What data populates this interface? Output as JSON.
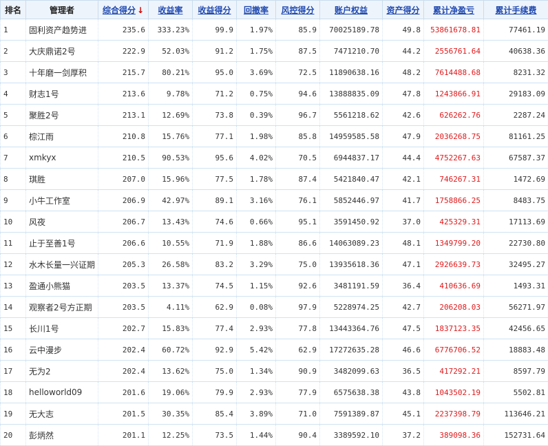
{
  "colors": {
    "header_bg": "#eef4fb",
    "link": "#1f49b0",
    "sort_arrow": "#d40000",
    "profit": "#e0191b"
  },
  "headers": {
    "rank": "排名",
    "manager": "管理者",
    "total_score": "综合得分",
    "sort_indicator": "↓",
    "return_rate": "收益率",
    "return_score": "收益得分",
    "drawdown": "回撤率",
    "risk_score": "风控得分",
    "equity": "账户权益",
    "asset_score": "资产得分",
    "net_profit": "累计净盈亏",
    "fees": "累计手续费"
  },
  "rows": [
    {
      "rank": "1",
      "name": "固利资产趋势进",
      "total": "235.6",
      "ret": "333.23%",
      "ret_score": "99.9",
      "dd": "1.97%",
      "risk": "85.9",
      "equity": "70025189.78",
      "asset": "49.8",
      "profit": "53861678.81",
      "fees": "77461.19"
    },
    {
      "rank": "2",
      "name": "大庆鼎诺2号",
      "total": "222.9",
      "ret": "52.03%",
      "ret_score": "91.2",
      "dd": "1.75%",
      "risk": "87.5",
      "equity": "7471210.70",
      "asset": "44.2",
      "profit": "2556761.64",
      "fees": "40638.36"
    },
    {
      "rank": "3",
      "name": "十年磨一剑厚积",
      "total": "215.7",
      "ret": "80.21%",
      "ret_score": "95.0",
      "dd": "3.69%",
      "risk": "72.5",
      "equity": "11890638.16",
      "asset": "48.2",
      "profit": "7614488.68",
      "fees": "8231.32"
    },
    {
      "rank": "4",
      "name": "财志1号",
      "total": "213.6",
      "ret": "9.78%",
      "ret_score": "71.2",
      "dd": "0.75%",
      "risk": "94.6",
      "equity": "13888835.09",
      "asset": "47.8",
      "profit": "1243866.91",
      "fees": "29183.09"
    },
    {
      "rank": "5",
      "name": "聚胜2号",
      "total": "213.1",
      "ret": "12.69%",
      "ret_score": "73.8",
      "dd": "0.39%",
      "risk": "96.7",
      "equity": "5561218.62",
      "asset": "42.6",
      "profit": "626262.76",
      "fees": "2287.24"
    },
    {
      "rank": "6",
      "name": "棕江雨",
      "total": "210.8",
      "ret": "15.76%",
      "ret_score": "77.1",
      "dd": "1.98%",
      "risk": "85.8",
      "equity": "14959585.58",
      "asset": "47.9",
      "profit": "2036268.75",
      "fees": "81161.25"
    },
    {
      "rank": "7",
      "name": "xmkyx",
      "total": "210.5",
      "ret": "90.53%",
      "ret_score": "95.6",
      "dd": "4.02%",
      "risk": "70.5",
      "equity": "6944837.17",
      "asset": "44.4",
      "profit": "4752267.63",
      "fees": "67587.37"
    },
    {
      "rank": "8",
      "name": "琪胜",
      "total": "207.0",
      "ret": "15.96%",
      "ret_score": "77.5",
      "dd": "1.78%",
      "risk": "87.4",
      "equity": "5421840.47",
      "asset": "42.1",
      "profit": "746267.31",
      "fees": "1472.69"
    },
    {
      "rank": "9",
      "name": "小牛工作室",
      "total": "206.9",
      "ret": "42.97%",
      "ret_score": "89.1",
      "dd": "3.16%",
      "risk": "76.1",
      "equity": "5852446.97",
      "asset": "41.7",
      "profit": "1758866.25",
      "fees": "8483.75"
    },
    {
      "rank": "10",
      "name": "风夜",
      "total": "206.7",
      "ret": "13.43%",
      "ret_score": "74.6",
      "dd": "0.66%",
      "risk": "95.1",
      "equity": "3591450.92",
      "asset": "37.0",
      "profit": "425329.31",
      "fees": "17113.69"
    },
    {
      "rank": "11",
      "name": "止于至善1号",
      "total": "206.6",
      "ret": "10.55%",
      "ret_score": "71.9",
      "dd": "1.88%",
      "risk": "86.6",
      "equity": "14063089.23",
      "asset": "48.1",
      "profit": "1349799.20",
      "fees": "22730.80"
    },
    {
      "rank": "12",
      "name": "水木长量一兴证期",
      "total": "205.3",
      "ret": "26.58%",
      "ret_score": "83.2",
      "dd": "3.29%",
      "risk": "75.0",
      "equity": "13935618.36",
      "asset": "47.1",
      "profit": "2926639.73",
      "fees": "32495.27"
    },
    {
      "rank": "13",
      "name": "盈通小熊猫",
      "total": "203.5",
      "ret": "13.37%",
      "ret_score": "74.5",
      "dd": "1.15%",
      "risk": "92.6",
      "equity": "3481191.59",
      "asset": "36.4",
      "profit": "410636.69",
      "fees": "1493.31"
    },
    {
      "rank": "14",
      "name": "观察者2号方正期",
      "total": "203.5",
      "ret": "4.11%",
      "ret_score": "62.9",
      "dd": "0.08%",
      "risk": "97.9",
      "equity": "5228974.25",
      "asset": "42.7",
      "profit": "206208.03",
      "fees": "56271.97"
    },
    {
      "rank": "15",
      "name": "长川1号",
      "total": "202.7",
      "ret": "15.83%",
      "ret_score": "77.4",
      "dd": "2.93%",
      "risk": "77.8",
      "equity": "13443364.76",
      "asset": "47.5",
      "profit": "1837123.35",
      "fees": "42456.65"
    },
    {
      "rank": "16",
      "name": "云中漫步",
      "total": "202.4",
      "ret": "60.72%",
      "ret_score": "92.9",
      "dd": "5.42%",
      "risk": "62.9",
      "equity": "17272635.28",
      "asset": "46.6",
      "profit": "6776706.52",
      "fees": "18883.48"
    },
    {
      "rank": "17",
      "name": "无为2",
      "total": "202.4",
      "ret": "13.62%",
      "ret_score": "75.0",
      "dd": "1.34%",
      "risk": "90.9",
      "equity": "3482099.63",
      "asset": "36.5",
      "profit": "417292.21",
      "fees": "8597.79"
    },
    {
      "rank": "18",
      "name": "helloworld09",
      "total": "201.6",
      "ret": "19.06%",
      "ret_score": "79.9",
      "dd": "2.93%",
      "risk": "77.9",
      "equity": "6575638.38",
      "asset": "43.8",
      "profit": "1043502.19",
      "fees": "5502.81"
    },
    {
      "rank": "19",
      "name": "无大志",
      "total": "201.5",
      "ret": "30.35%",
      "ret_score": "85.4",
      "dd": "3.89%",
      "risk": "71.0",
      "equity": "7591389.87",
      "asset": "45.1",
      "profit": "2237398.79",
      "fees": "113646.21"
    },
    {
      "rank": "20",
      "name": "彭炳然",
      "total": "201.1",
      "ret": "12.25%",
      "ret_score": "73.5",
      "dd": "1.44%",
      "risk": "90.4",
      "equity": "3389592.10",
      "asset": "37.2",
      "profit": "389098.36",
      "fees": "152731.64"
    }
  ]
}
